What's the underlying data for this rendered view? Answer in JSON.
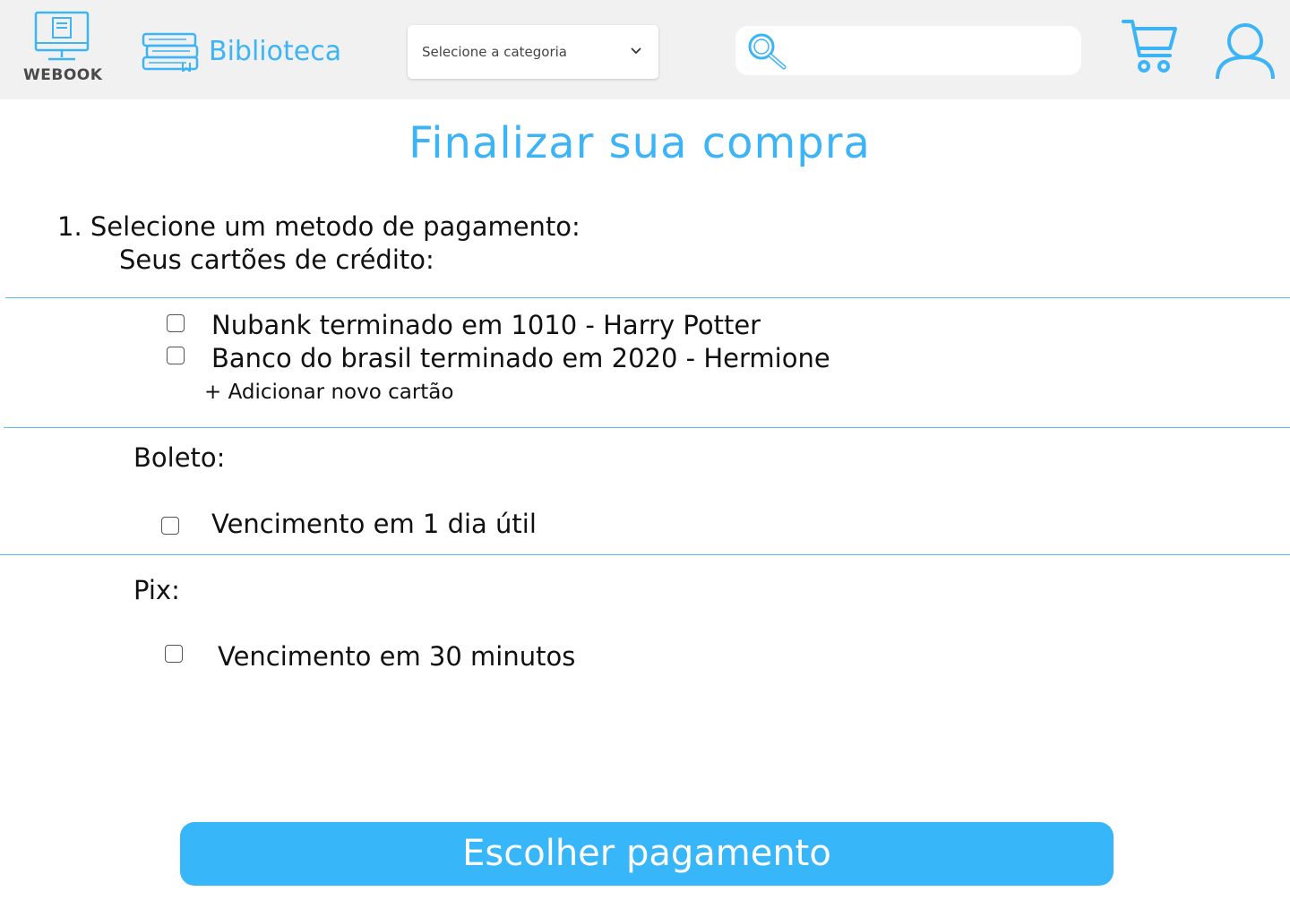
{
  "header": {
    "logo_text": "WEBOOK",
    "library_label": "Biblioteca",
    "category_placeholder": "Selecione a categoria",
    "search_value": ""
  },
  "main": {
    "title": "Finalizar sua compra",
    "step_label": "1. Selecione um metodo de pagamento:",
    "cards_label": "Seus cartões de crédito:",
    "cards": [
      "Nubank terminado em 1010 - Harry Potter",
      "Banco do brasil terminado em 2020 - Hermione"
    ],
    "add_card": "+ Adicionar novo cartão",
    "boleto_label": "Boleto:",
    "boleto_option": "Vencimento em 1 dia útil",
    "pix_label": "Pix:",
    "pix_option": "Vencimento em 30 minutos",
    "submit_label": "Escolher pagamento"
  },
  "colors": {
    "accent": "#3db4f5",
    "button": "#38b6fa",
    "header_bg": "#f1f1f1",
    "divider": "#5cbde9"
  }
}
